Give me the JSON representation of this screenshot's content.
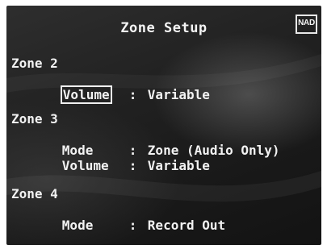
{
  "title": "Zone Setup",
  "logo": "NAD",
  "zones": [
    {
      "name": "Zone 2",
      "rows": [
        {
          "label": "Volume",
          "separator": ":",
          "value": "Variable",
          "selected": true
        }
      ]
    },
    {
      "name": "Zone 3",
      "rows": [
        {
          "label": "Mode",
          "separator": ":",
          "value": "Zone (Audio Only)",
          "selected": false
        },
        {
          "label": "Volume",
          "separator": ":",
          "value": "Variable",
          "selected": false
        }
      ]
    },
    {
      "name": "Zone 4",
      "rows": [
        {
          "label": "Mode",
          "separator": ":",
          "value": "Record Out",
          "selected": false
        }
      ]
    }
  ],
  "colors": {
    "background": "#1e1e1e",
    "text": "#f2f2f2",
    "highlight_border": "#f0f0f0"
  }
}
